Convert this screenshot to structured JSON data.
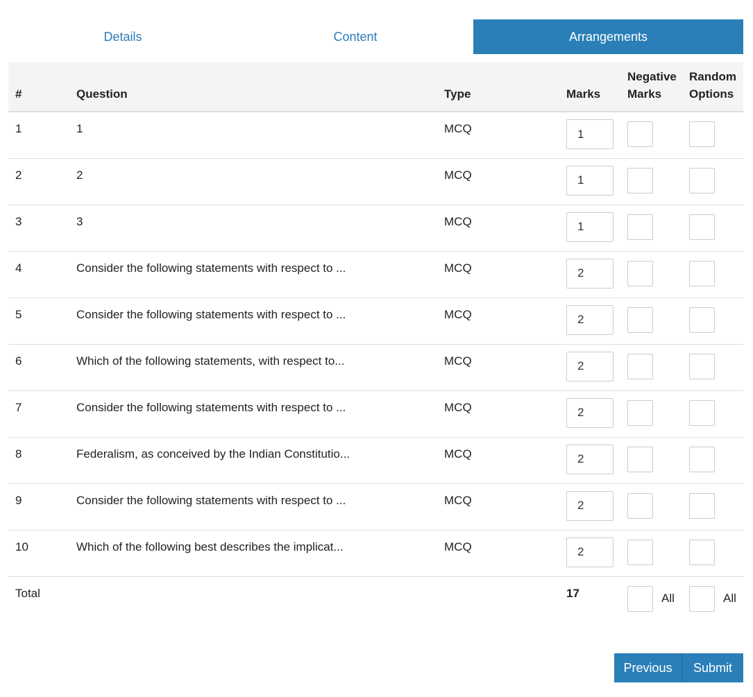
{
  "tabs": [
    {
      "label": "Details",
      "active": false
    },
    {
      "label": "Content",
      "active": false
    },
    {
      "label": "Arrangements",
      "active": true
    }
  ],
  "table": {
    "headers": {
      "num": "#",
      "question": "Question",
      "type": "Type",
      "marks": "Marks",
      "negative_marks_line1": "Negative",
      "negative_marks_line2": "Marks",
      "random_options_line1": "Random",
      "random_options_line2": "Options"
    },
    "rows": [
      {
        "num": "1",
        "question": "1",
        "type": "MCQ",
        "marks": "1",
        "negative": false,
        "random": false
      },
      {
        "num": "2",
        "question": "2",
        "type": "MCQ",
        "marks": "1",
        "negative": false,
        "random": false
      },
      {
        "num": "3",
        "question": "3",
        "type": "MCQ",
        "marks": "1",
        "negative": false,
        "random": false
      },
      {
        "num": "4",
        "question": "Consider the following statements with respect to ...",
        "type": "MCQ",
        "marks": "2",
        "negative": false,
        "random": false
      },
      {
        "num": "5",
        "question": "Consider the following statements with respect to ...",
        "type": "MCQ",
        "marks": "2",
        "negative": false,
        "random": false
      },
      {
        "num": "6",
        "question": "Which of the following statements, with respect to...",
        "type": "MCQ",
        "marks": "2",
        "negative": false,
        "random": false
      },
      {
        "num": "7",
        "question": "Consider the following statements with respect to ...",
        "type": "MCQ",
        "marks": "2",
        "negative": false,
        "random": false
      },
      {
        "num": "8",
        "question": "Federalism, as conceived by the Indian Constitutio...",
        "type": "MCQ",
        "marks": "2",
        "negative": false,
        "random": false
      },
      {
        "num": "9",
        "question": "Consider the following statements with respect to ...",
        "type": "MCQ",
        "marks": "2",
        "negative": false,
        "random": false
      },
      {
        "num": "10",
        "question": "Which of the following best describes the implicat...",
        "type": "MCQ",
        "marks": "2",
        "negative": false,
        "random": false
      }
    ],
    "footer": {
      "label": "Total",
      "total_marks": "17",
      "negative_all_label": "All",
      "random_all_label": "All"
    }
  },
  "buttons": {
    "previous": "Previous",
    "submit": "Submit"
  },
  "colors": {
    "accent": "#2b7fb8",
    "tab_text": "#2b7bb9",
    "header_bg": "#f4f4f4",
    "border": "#dddddd"
  }
}
